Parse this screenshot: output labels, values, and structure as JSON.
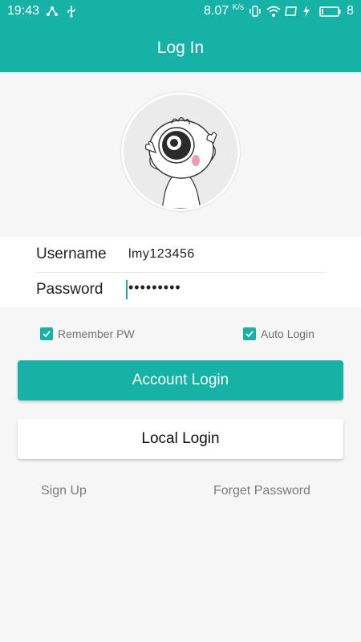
{
  "status_bar": {
    "time": "19:43",
    "network_speed": "8.07",
    "speed_unit": "K/s",
    "battery_level": "8",
    "icons": [
      "share-icon",
      "usb-icon",
      "vibrate-icon",
      "wifi-icon",
      "screen-icon",
      "charging-icon",
      "battery-icon"
    ]
  },
  "header": {
    "title": "Log In"
  },
  "form": {
    "username_label": "Username",
    "username_value": "lmy123456",
    "password_label": "Password",
    "password_value": "•••••••••"
  },
  "options": {
    "remember_label": "Remember PW",
    "remember_checked": true,
    "auto_label": "Auto Login",
    "auto_checked": true
  },
  "buttons": {
    "account_login": "Account Login",
    "local_login": "Local Login"
  },
  "links": {
    "sign_up": "Sign Up",
    "forget_password": "Forget Password"
  },
  "colors": {
    "accent": "#16b2a6",
    "background": "#f6f6f6"
  }
}
